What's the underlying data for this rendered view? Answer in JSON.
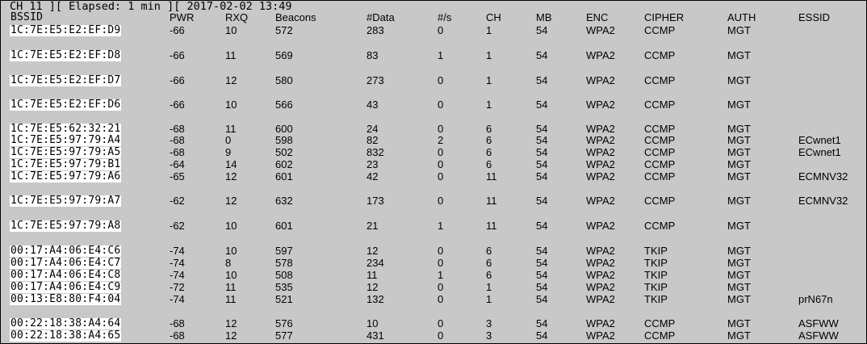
{
  "status_line": "CH 11 ][ Elapsed: 1 min ][ 2017-02-02 13:49",
  "columns": [
    "BSSID",
    "PWR",
    "RXQ",
    "Beacons",
    "#Data",
    "#/s",
    "CH",
    "MB",
    "ENC",
    "CIPHER",
    "AUTH",
    "ESSID"
  ],
  "rows": [
    {
      "bssid": "1C:7E:E5:E2:EF:D9",
      "pwr": "-66",
      "rxq": "10",
      "beacons": "572",
      "data": "283",
      "rate": "0",
      "ch": "1",
      "mb": "54",
      "enc": "WPA2",
      "cipher": "CCMP",
      "auth": "MGT",
      "essid": ""
    },
    {
      "bssid": "1C:7E:E5:E2:EF:D8",
      "pwr": "-66",
      "rxq": "11",
      "beacons": "569",
      "data": "83",
      "rate": "1",
      "ch": "1",
      "mb": "54",
      "enc": "WPA2",
      "cipher": "CCMP",
      "auth": "MGT",
      "essid": ""
    },
    {
      "bssid": "1C:7E:E5:E2:EF:D7",
      "pwr": "-66",
      "rxq": "12",
      "beacons": "580",
      "data": "273",
      "rate": "0",
      "ch": "1",
      "mb": "54",
      "enc": "WPA2",
      "cipher": "CCMP",
      "auth": "MGT",
      "essid": ""
    },
    {
      "bssid": "1C:7E:E5:E2:EF:D6",
      "pwr": "-66",
      "rxq": "10",
      "beacons": "566",
      "data": "43",
      "rate": "0",
      "ch": "1",
      "mb": "54",
      "enc": "WPA2",
      "cipher": "CCMP",
      "auth": "MGT",
      "essid": ""
    },
    {
      "bssid": "1C:7E:E5:62:32:21",
      "pwr": "-68",
      "rxq": "11",
      "beacons": "600",
      "data": "24",
      "rate": "0",
      "ch": "6",
      "mb": "54",
      "enc": "WPA2",
      "cipher": "CCMP",
      "auth": "MGT",
      "essid": ""
    },
    {
      "bssid": "1C:7E:E5:97:79:A4",
      "pwr": "-68",
      "rxq": "0",
      "beacons": "598",
      "data": "82",
      "rate": "2",
      "ch": "6",
      "mb": "54",
      "enc": "WPA2",
      "cipher": "CCMP",
      "auth": "MGT",
      "essid": "ECwnet1"
    },
    {
      "bssid": "1C:7E:E5:97:79:A5",
      "pwr": "-68",
      "rxq": "9",
      "beacons": "502",
      "data": "832",
      "rate": "0",
      "ch": "6",
      "mb": "54",
      "enc": "WPA2",
      "cipher": "CCMP",
      "auth": "MGT",
      "essid": "ECwnet1"
    },
    {
      "bssid": "1C:7E:E5:97:79:B1",
      "pwr": "-64",
      "rxq": "14",
      "beacons": "602",
      "data": "23",
      "rate": "0",
      "ch": "6",
      "mb": "54",
      "enc": "WPA2",
      "cipher": "CCMP",
      "auth": "MGT",
      "essid": ""
    },
    {
      "bssid": "1C:7E:E5:97:79:A6",
      "pwr": "-65",
      "rxq": "12",
      "beacons": "601",
      "data": "42",
      "rate": "0",
      "ch": "11",
      "mb": "54",
      "enc": "WPA2",
      "cipher": "CCMP",
      "auth": "MGT",
      "essid": "ECMNV32"
    },
    {
      "bssid": "1C:7E:E5:97:79:A7",
      "pwr": "-62",
      "rxq": "12",
      "beacons": "632",
      "data": "173",
      "rate": "0",
      "ch": "11",
      "mb": "54",
      "enc": "WPA2",
      "cipher": "CCMP",
      "auth": "MGT",
      "essid": "ECMNV32"
    },
    {
      "bssid": "1C:7E:E5:97:79:A8",
      "pwr": "-62",
      "rxq": "10",
      "beacons": "601",
      "data": "21",
      "rate": "1",
      "ch": "11",
      "mb": "54",
      "enc": "WPA2",
      "cipher": "CCMP",
      "auth": "MGT",
      "essid": ""
    },
    {
      "bssid": "00:17:A4:06:E4:C6",
      "pwr": "-74",
      "rxq": "10",
      "beacons": "597",
      "data": "12",
      "rate": "0",
      "ch": "6",
      "mb": "54",
      "enc": "WPA2",
      "cipher": "TKIP",
      "auth": "MGT",
      "essid": ""
    },
    {
      "bssid": "00:17:A4:06:E4:C7",
      "pwr": "-74",
      "rxq": "8",
      "beacons": "578",
      "data": "234",
      "rate": "0",
      "ch": "6",
      "mb": "54",
      "enc": "WPA2",
      "cipher": "TKIP",
      "auth": "MGT",
      "essid": ""
    },
    {
      "bssid": "00:17:A4:06:E4:C8",
      "pwr": "-74",
      "rxq": "10",
      "beacons": "508",
      "data": "11",
      "rate": "1",
      "ch": "6",
      "mb": "54",
      "enc": "WPA2",
      "cipher": "TKIP",
      "auth": "MGT",
      "essid": ""
    },
    {
      "bssid": "00:17:A4:06:E4:C9",
      "pwr": "-72",
      "rxq": "11",
      "beacons": "535",
      "data": "12",
      "rate": "0",
      "ch": "1",
      "mb": "54",
      "enc": "WPA2",
      "cipher": "TKIP",
      "auth": "MGT",
      "essid": ""
    },
    {
      "bssid": "00:13:E8:80:F4:04",
      "pwr": "-74",
      "rxq": "11",
      "beacons": "521",
      "data": "132",
      "rate": "0",
      "ch": "1",
      "mb": "54",
      "enc": "WPA2",
      "cipher": "TKIP",
      "auth": "MGT",
      "essid": "prN67n"
    },
    {
      "bssid": "00:22:18:38:A4:64",
      "pwr": "-68",
      "rxq": "12",
      "beacons": "576",
      "data": "10",
      "rate": "0",
      "ch": "3",
      "mb": "54",
      "enc": "WPA2",
      "cipher": "CCMP",
      "auth": "MGT",
      "essid": "ASFWW"
    },
    {
      "bssid": "00:22:18:38:A4:65",
      "pwr": "-68",
      "rxq": "12",
      "beacons": "577",
      "data": "431",
      "rate": "0",
      "ch": "3",
      "mb": "54",
      "enc": "WPA2",
      "cipher": "CCMP",
      "auth": "MGT",
      "essid": "ASFWW"
    }
  ]
}
